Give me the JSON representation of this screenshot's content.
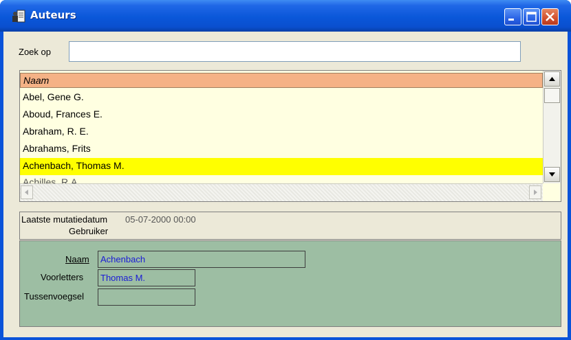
{
  "window": {
    "title": "Auteurs",
    "icon": "book-user-icon",
    "controls": [
      "minimize-icon",
      "maximize-icon",
      "close-icon"
    ]
  },
  "search": {
    "label": "Zoek op",
    "value": ""
  },
  "list": {
    "header": "Naam",
    "rows": [
      "Abel, Gene G.",
      "Aboud, Frances E.",
      "Abraham, R. E.",
      "Abrahams, Frits",
      "Achenbach, Thomas M.",
      "Achilles, R.A."
    ],
    "selected_index": 4,
    "selected_color": "#ffff00",
    "row_background": "#ffffe1",
    "header_background": "#f5b286"
  },
  "info": {
    "mutation_label": "Laatste mutatiedatum",
    "mutation_date": "05-07-2000 00:00",
    "user_label": "Gebruiker"
  },
  "detail": {
    "background": "#9dbea3",
    "naam_label": "Naam",
    "naam_value": "Achenbach",
    "voorletters_label": "Voorletters",
    "voorletters_value": "Thomas M.",
    "tussenvoegsel_label": "Tussenvoegsel",
    "tussenvoegsel_value": ""
  }
}
